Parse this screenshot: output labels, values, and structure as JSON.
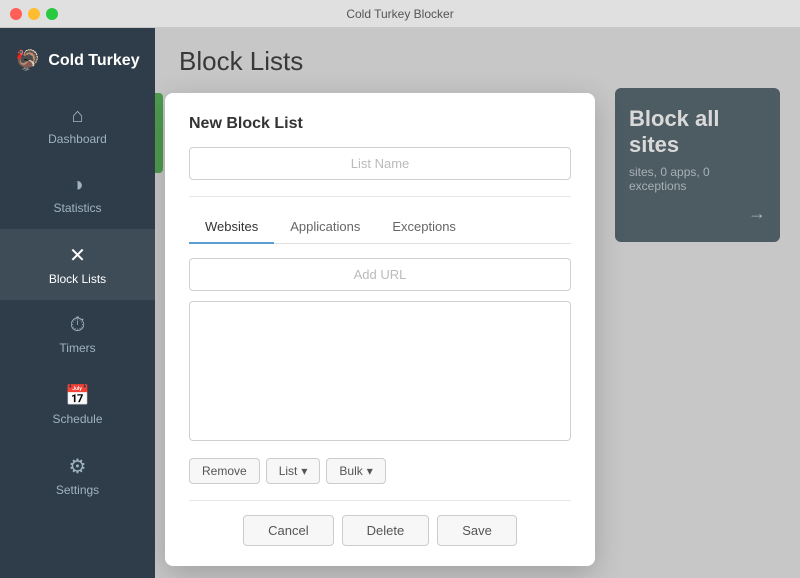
{
  "titlebar": {
    "title": "Cold Turkey Blocker"
  },
  "sidebar": {
    "brand": "Cold Turkey",
    "brand_icon": "🦃",
    "items": [
      {
        "id": "dashboard",
        "label": "Dashboard",
        "icon": "⌂",
        "active": false
      },
      {
        "id": "statistics",
        "label": "Statistics",
        "icon": "◑",
        "active": false
      },
      {
        "id": "block-lists",
        "label": "Block Lists",
        "icon": "✕",
        "active": true
      },
      {
        "id": "timers",
        "label": "Timers",
        "icon": "⏱",
        "active": false
      },
      {
        "id": "schedule",
        "label": "Schedule",
        "icon": "📅",
        "active": false
      },
      {
        "id": "settings",
        "label": "Settings",
        "icon": "⚙",
        "active": false
      }
    ]
  },
  "main": {
    "title": "Block Lists"
  },
  "block_all_card": {
    "title": "Block all sites",
    "subtitle": "sites, 0 apps, 0 exceptions",
    "arrow": "→"
  },
  "dialog": {
    "title": "New Block List",
    "list_name_placeholder": "List Name",
    "tabs": [
      {
        "id": "websites",
        "label": "Websites",
        "active": true
      },
      {
        "id": "applications",
        "label": "Applications",
        "active": false
      },
      {
        "id": "exceptions",
        "label": "Exceptions",
        "active": false
      }
    ],
    "add_url_placeholder": "Add URL",
    "buttons": {
      "remove": "Remove",
      "list": "List",
      "bulk": "Bulk",
      "cancel": "Cancel",
      "delete": "Delete",
      "save": "Save"
    }
  }
}
